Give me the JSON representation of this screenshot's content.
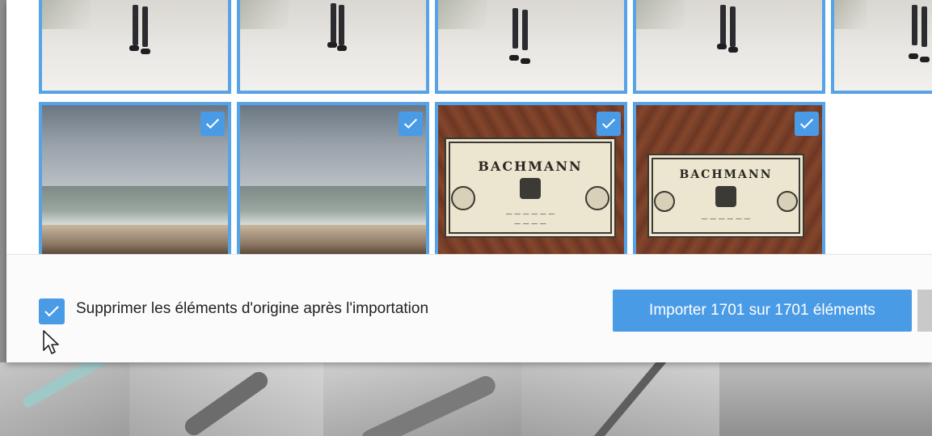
{
  "dialog": {
    "delete_originals_label": "Supprimer les éléments d'origine après l'importation",
    "delete_originals_checked": true,
    "import_button_label": "Importer 1701 sur 1701 éléments"
  },
  "thumbnails_row1": [
    {
      "kind": "photo",
      "selected": true
    },
    {
      "kind": "photo",
      "selected": true
    },
    {
      "kind": "photo",
      "selected": true
    },
    {
      "kind": "photo",
      "selected": true
    },
    {
      "kind": "photo",
      "selected": true
    }
  ],
  "thumbnails_row2": [
    {
      "kind": "photo",
      "selected": true
    },
    {
      "kind": "photo",
      "selected": true
    },
    {
      "kind": "photo",
      "selected": true,
      "label_text": "BACHMANN"
    },
    {
      "kind": "photo",
      "selected": true,
      "label_text": "BACHMANN"
    }
  ],
  "colors": {
    "accent": "#4a9be6",
    "selection_border": "#56a3e8"
  },
  "icons": [
    "checkmark-icon",
    "mouse-pointer-icon"
  ]
}
